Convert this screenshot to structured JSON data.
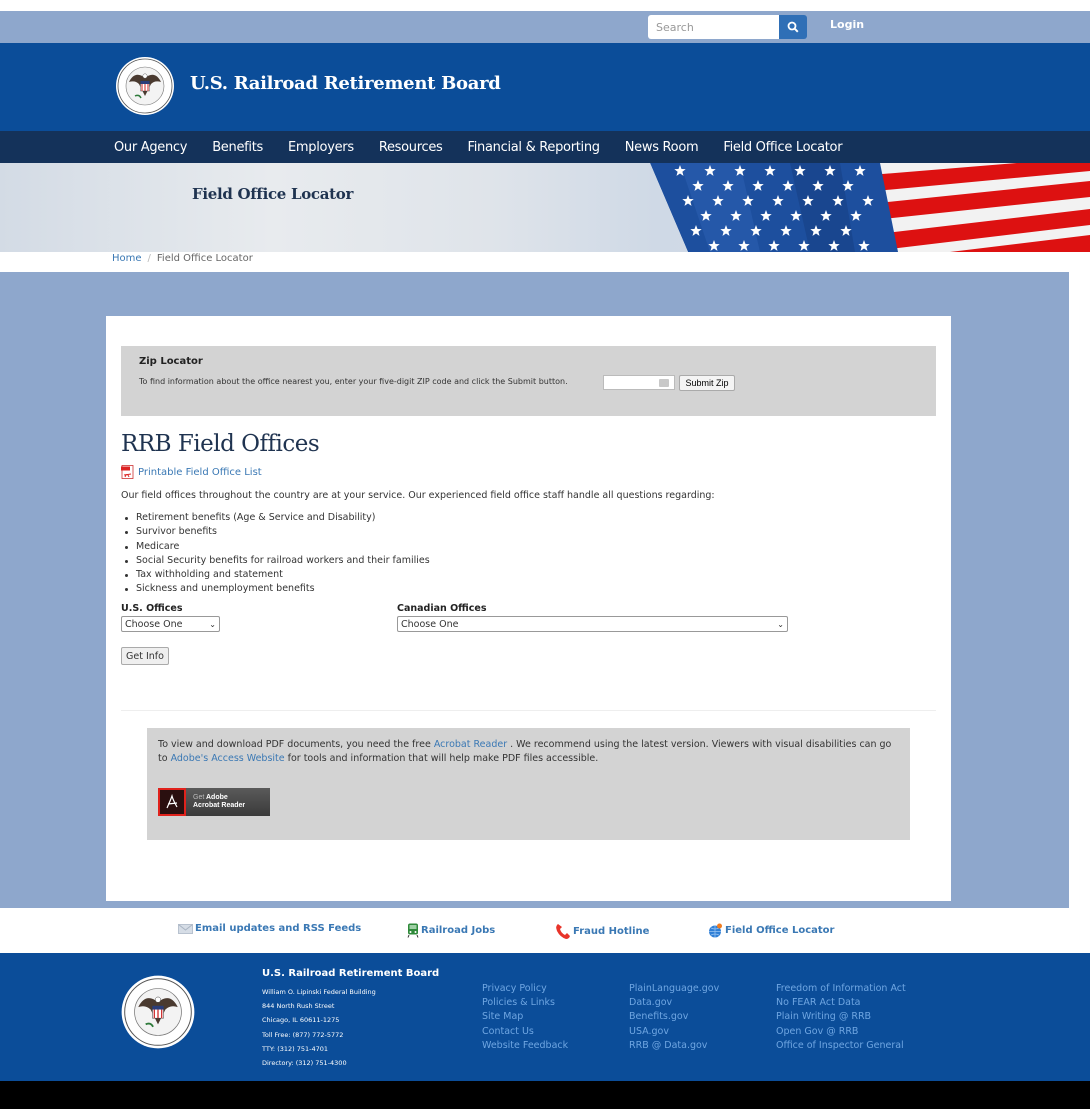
{
  "topbar": {
    "search_placeholder": "Search",
    "search_icon": "magnifier-icon",
    "login_label": "Login"
  },
  "header": {
    "site_title": "U.S. Railroad Retirement Board",
    "seal_icon": "rrb-seal-icon"
  },
  "nav": {
    "items": [
      {
        "label": "Our Agency"
      },
      {
        "label": "Benefits"
      },
      {
        "label": "Employers"
      },
      {
        "label": "Resources"
      },
      {
        "label": "Financial & Reporting"
      },
      {
        "label": "News Room"
      },
      {
        "label": "Field Office Locator"
      }
    ]
  },
  "hero": {
    "title": "Field Office Locator"
  },
  "breadcrumb": {
    "home": "Home",
    "separator": "/",
    "current": "Field Office Locator"
  },
  "zip_locator": {
    "title": "Zip Locator",
    "instructions": "To find information about the office nearest you, enter your five-digit ZIP code and click the Submit button.",
    "zip_value": "",
    "submit_label": "Submit Zip"
  },
  "main": {
    "title": "RRB Field Offices",
    "pdf_link": "Printable Field Office List",
    "intro": "Our field offices throughout the country are at your service.  Our experienced field office staff handle all questions regarding:",
    "benefits": [
      "Retirement benefits (Age & Service and Disability)",
      "Survivor benefits",
      "Medicare",
      "Social Security benefits for railroad workers and their families",
      "Tax withholding and statement",
      "Sickness and unemployment benefits"
    ],
    "us_offices_label": "U.S. Offices",
    "us_offices_selected": "Choose One",
    "canadian_offices_label": "Canadian Offices",
    "canadian_offices_selected": "Choose One",
    "get_info_label": "Get Info"
  },
  "pdf_notice": {
    "text_1": "To view and download PDF documents, you need the free ",
    "link_1": "Acrobat Reader",
    "text_2": " . We recommend using the latest version. Viewers with visual disabilities can go to ",
    "link_2": "Adobe's Access Website",
    "text_3": " for tools and information that will help make PDF files accessible.",
    "button_get": "Get",
    "button_brand": "Adobe",
    "button_product": "Acrobat Reader"
  },
  "quick_links": [
    {
      "label": "Email updates and RSS Feeds",
      "icon": "envelope-icon"
    },
    {
      "label": "Railroad Jobs",
      "icon": "train-icon"
    },
    {
      "label": "Fraud Hotline",
      "icon": "phone-icon"
    },
    {
      "label": "Field Office Locator",
      "icon": "globe-pin-icon"
    }
  ],
  "footer": {
    "org": "U.S. Railroad Retirement Board",
    "address": [
      "William O. Lipinski Federal Building",
      "844 North Rush Street",
      "Chicago, IL 60611-1275",
      "Toll Free: (877) 772-5772",
      "TTY: (312) 751-4701",
      "Directory: (312) 751-4300"
    ],
    "col1": [
      "Privacy Policy",
      "Policies & Links",
      "Site Map",
      "Contact Us",
      "Website Feedback"
    ],
    "col2": [
      "PlainLanguage.gov",
      "Data.gov",
      "Benefits.gov",
      "USA.gov",
      "RRB @ Data.gov"
    ],
    "col3": [
      "Freedom of Information Act",
      "No FEAR Act Data",
      "Plain Writing @ RRB",
      "Open Gov @ RRB",
      "Office of Inspector General"
    ]
  },
  "colors": {
    "header_blue": "#0b4d99",
    "nav_navy": "#14325a",
    "page_bg_blue": "#8ea7cc",
    "link_blue": "#3a78b4",
    "footer_link": "#6fa6e2",
    "panel_gray": "#d3d3d3"
  }
}
